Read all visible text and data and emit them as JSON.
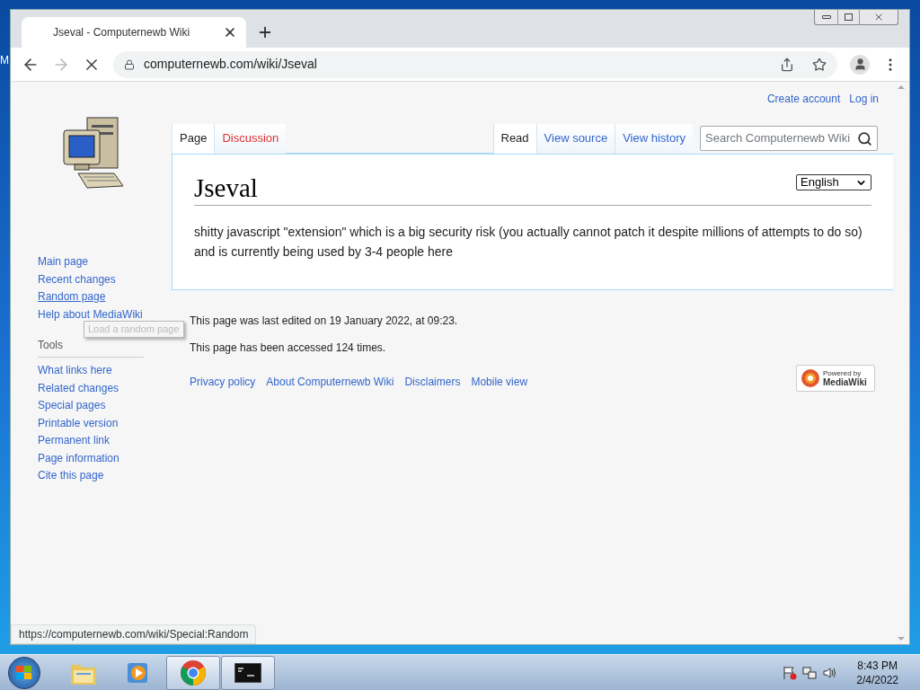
{
  "desktop": {
    "icon_label": "M"
  },
  "browser": {
    "tabs": [
      {
        "title": "Jseval - Computernewb Wiki",
        "selected": true
      }
    ],
    "url": "computernewb.com/wiki/Jseval",
    "loading": true,
    "status_url": "https://computernewb.com/wiki/Special:Random"
  },
  "wiki": {
    "personal_links": [
      "Create account",
      "Log in"
    ],
    "left_tabs": [
      {
        "label": "Page",
        "selected": true,
        "redlink": false
      },
      {
        "label": "Discussion",
        "selected": false,
        "redlink": true
      }
    ],
    "right_tabs": [
      {
        "label": "Read",
        "selected": true
      },
      {
        "label": "View source",
        "selected": false
      },
      {
        "label": "View history",
        "selected": false
      }
    ],
    "search": {
      "placeholder": "Search Computernewb Wiki"
    },
    "navigation": [
      {
        "label": "Main page",
        "hovered": false
      },
      {
        "label": "Recent changes",
        "hovered": false
      },
      {
        "label": "Random page",
        "hovered": true
      },
      {
        "label": "Help about MediaWiki",
        "hovered": false
      }
    ],
    "tooltip": "Load a random page",
    "tools_heading": "Tools",
    "tools": [
      "What links here",
      "Related changes",
      "Special pages",
      "Printable version",
      "Permanent link",
      "Page information",
      "Cite this page"
    ],
    "title": "Jseval",
    "language": "English",
    "body": "shitty javascript \"extension\" which is a big security risk (you actually cannot patch it despite millions of attempts to do so) and is currently being used by 3-4 people here",
    "footer_info": [
      "This page was last edited on 19 January 2022, at 09:23.",
      "This page has been accessed 124 times."
    ],
    "footer_links": [
      "Privacy policy",
      "About Computernewb Wiki",
      "Disclaimers",
      "Mobile view"
    ],
    "powered_by": [
      "Powered by",
      "MediaWiki"
    ]
  },
  "taskbar": {
    "apps": [
      {
        "kind": "explorer",
        "running": false
      },
      {
        "kind": "media",
        "running": false
      },
      {
        "kind": "chrome",
        "running": true
      },
      {
        "kind": "cmd",
        "running": true
      }
    ],
    "time": "8:43 PM",
    "date": "2/4/2022"
  }
}
